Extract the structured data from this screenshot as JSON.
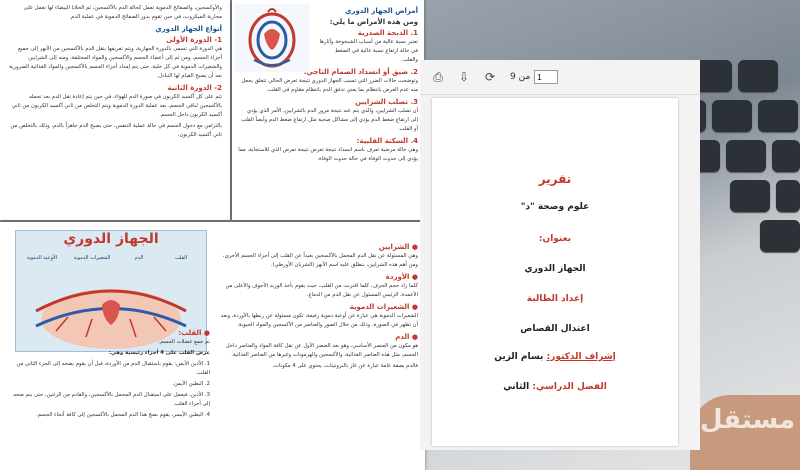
{
  "viewer": {
    "page_label": "من 9",
    "page_value": "1"
  },
  "cover": {
    "report": "تقرير",
    "subject": "علوم وصحة \"د\"",
    "title_label": "بعنوان:",
    "title": "الجهاز الدوري",
    "prepared_label": "إعداد الطالبة",
    "student": "اعتدال القصاص",
    "supervisor_label": "إشراف الدكتور:",
    "supervisor": "بسام الزين",
    "semester_label": "الفصل الدراسي:",
    "semester": "الثاني"
  },
  "page1": {
    "top_para": "والأوكسجين، والصفائح الدموية تعمل كحالة الدم بالأكسجين، ثم الخلايا البيضاء لها تعمل على محاربة الميكروب، في حين تقوم بدور الصفائح الدموية في عملية الدم.",
    "types_heading": "أنواع الجهاز الدوري",
    "sub1": "1- الدورة الأولى",
    "sub1_para": "هي الدورة التي تسمى بالدورة الجهارية، ويتم تعريفها بنقل الدم بالأكسجين من الأبهر إلى جميع أجزاء الجسم، ومن ثم إلى أعضاء الجسم والأكسجين والمواد المختلفة، ومنه إلى الشرايين والشعيرات الدموية في كل خلية، حتى يتم إمداد أجزاء الجسم بالأكسجين والمواد الغذائية الضرورية بعد أن يصبح القيام لها التبادل.",
    "sub2": "2- الدورة الثانية",
    "sub2_para": "تتم على كل أكسيد الكربون في صورة الدم للهواء، في حين يتم إعادة نقل الدم بعد تحمله بالأكسجين لباقي الجسم، بعد عملية الدورة الدموية ويتم التخلص من ثاني أكسيد الكربون من ثاني أكسيد الكربون داخل الجسم.",
    "sub2_para2": "بالتزامن مع دخول الجسم في حالة عملية التنفس، حتى يصبح الدم جاهزاً بالدم، وذلك بالتخلص من ثاني أكسيد الكربون."
  },
  "page2": {
    "heading": "أمراض الجهاز الدوري",
    "intro": "ومن هذه الأمراض ما يلي:",
    "d1": "1. الذبحة الصدرية",
    "d1_para": "تعتبر نسبة عالية من أسباب الشيخوخة وآثارها في حالة ارتفاع نسبة عالية في الضغط والقلب.",
    "d2": "2. ضيق أو انسداد الصمام التاجي:",
    "d2_para": "وتوضحت حالات الضرر التي تسبب الجهاز الدوري نتيجة تعرض الحالي تتعلق يجعل منه عدم العرض بانتظام بما يعني تدفق الدم بانتظام مقاوم في القلب.",
    "d3": "3. تصلب الشرايين",
    "d3_para": "أن تصلب الشرايين، والذي يتم عنه نتيجة مرور الدم بالشرايين، الأمر الذي يؤدي إلى ارتفاع ضغط الدم يؤدي إلى مشاكل صحية مثل ارتفاع ضغط الدم وأيضاً القلب أو القلب.",
    "d4": "4. السكتة القلبية:",
    "d4_para": "وهي حالة مرضية تعرف باسم انسداد نتيجة تعرض نتيجة تعرض الذي للاستجابة، مما يؤدي إلى حدوث الوفاة في حالة حدوث الوفاة."
  },
  "page3": {
    "diagram_title": "الجهاز الدوري",
    "lbl_heart": "القلب",
    "lbl_blood": "الدم",
    "lbl_capillaries": "الشعيرات الدموية",
    "lbl_vessels": "الأوعية الدموية",
    "heart_bullet": "القلب:",
    "heart_intro": "تم جمع عضلات الجسم.",
    "heart_parts": "عرض القلب على 4 أجزاء رئيسية وهي:",
    "part1": "1. الأذين الأيمن: يقوم باستقبال الدم من الأوردة، قبل أن يقوم بضخه إلى الجزء الثاني من القلب.",
    "part2": "2. البطين الأيمن.",
    "part3": "3. الأذين، فيعمل على استقبال الدم المحمل بالأكسجين، والقادم من الرئتين، حتى يتم ضخه إلى أجزاء القلب.",
    "part4": "4. البطين الأيسر، يقوم بضخ هذا الدم المحمل بالأكسجين إلى كافة أنحاء الجسم.",
    "arteries": "الشرايين",
    "arteries_para": "وهي المسئولة عن نقل الدم المحمل بالأكسجين بعيداً عن القلب إلى أجزاء الجسم الأخرى، ومن أهم هذه الشرايين، بنطلق عليه اسم الأبهر (الشريان الأورطي).",
    "veins": "الأوردة",
    "veins_para": "كلما زاد حجم الحرف، كلما اقتربت من القلب، حيث يقوم بأخذ الوريد الأجوف والأعلى من الأعمدة، الرئيس المسئول عن نقل الدم من الدماغ.",
    "capillaries": "الشعيرات الدموية",
    "capillaries_para": "الشعيرات الدموية هي عبارة عن أوعية دموية رفيعة، تكون مسئولة عن ربطها بالأوردة، وبعد أن تظهر في الصورة، وذلك من خلال الصور والعناصر من الأكسجين والمواد الحيوية.",
    "blood": "الدم",
    "blood_para": "هو مكون من العنصر الأساسي، وهو بعد العنصر الأول عن نقل كافة المواد والعناصر داخل الجسم، مثل هذه العناصر الغذائية، والأكسجين والهرمونات وغيرها من العناصر الغذائية.",
    "blood_para2": "فالدم بصفة عامة عبارة عن غاز بالبروتينات، يحتوي على 4 مكونات،"
  },
  "watermark": "مستقل"
}
